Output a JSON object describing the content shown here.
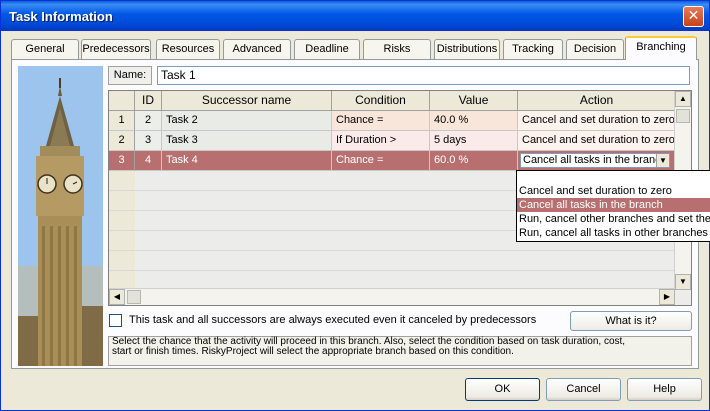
{
  "window": {
    "title": "Task Information"
  },
  "tabs": [
    "General",
    "Predecessors",
    "Resources",
    "Advanced",
    "Deadline",
    "Risks",
    "Distributions",
    "Tracking",
    "Decision",
    "Branching"
  ],
  "active_tab": "Branching",
  "name": {
    "label": "Name:",
    "value": "Task 1"
  },
  "grid": {
    "columns": [
      "",
      "ID",
      "Successor name",
      "Condition",
      "Value",
      "Action"
    ],
    "rows": [
      {
        "num": "1",
        "id": "2",
        "successor": "Task 2",
        "condition": "Chance =",
        "value": "40.0 %",
        "action": "Cancel and set duration to zero"
      },
      {
        "num": "2",
        "id": "3",
        "successor": "Task 3",
        "condition": "If Duration >",
        "value": "5 days",
        "action": "Cancel and set duration to zero"
      },
      {
        "num": "3",
        "id": "4",
        "successor": "Task 4",
        "condition": "Chance =",
        "value": "60.0 %",
        "action": "Cancel all tasks in the branch"
      }
    ],
    "dropdown_options": [
      "Cancel and set duration to zero",
      "Cancel all tasks in the branch",
      "Run, cancel other branches and set their",
      "Run, cancel all tasks in other branches"
    ],
    "dropdown_selected": "Cancel all tasks in the branch"
  },
  "checkbox": {
    "label": "This task and all successors are always executed even it canceled by predecessors",
    "checked": false
  },
  "whatis_label": "What is it?",
  "description": [
    "Select the chance that the activity will proceed in this branch. Also, select the condition based on task duration, cost,",
    "start or finish times. RiskyProject will select the appropriate branch based on this condition."
  ],
  "buttons": {
    "ok": "OK",
    "cancel": "Cancel",
    "help": "Help"
  },
  "colors": {
    "title_bar": "#0058e6",
    "selected_row": "#b86f6f",
    "row1": "#f4e9e2",
    "row2": "#ecefe9"
  }
}
